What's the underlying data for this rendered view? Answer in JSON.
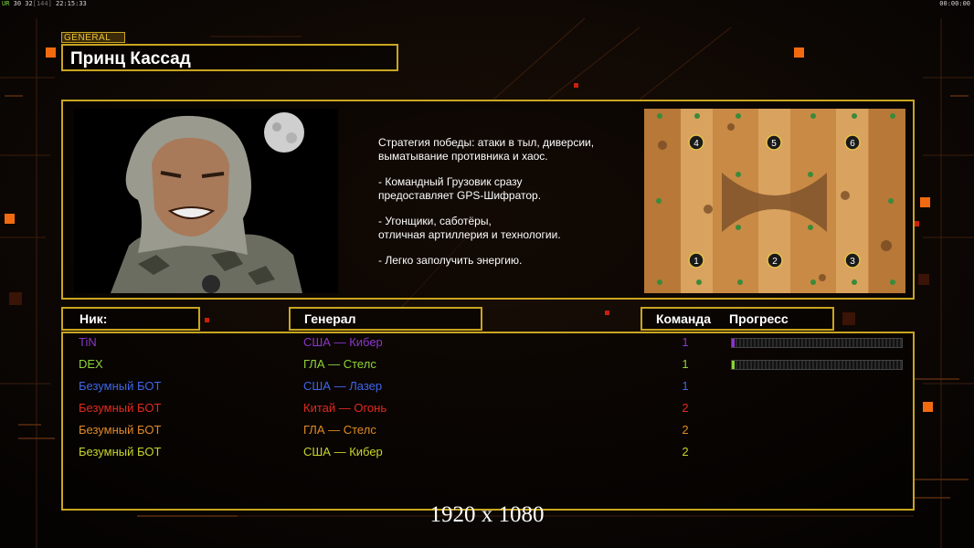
{
  "hud": {
    "left": {
      "a": "UR",
      "b": "30 32",
      "c": "[144]",
      "d": "22:15:33"
    },
    "right": "00:00:00"
  },
  "general": {
    "tag": "GENERAL",
    "name": "Принц Кассад"
  },
  "description": [
    "Стратегия победы: атаки в тыл, диверсии,\n выматывание противника и хаос.",
    "- Командный Грузовик сразу\nпредоставляет GPS-Шифратор.",
    "- Угонщики, саботёры,\nотличная артиллерия и технологии.",
    "- Легко заполучить энергию."
  ],
  "map": {
    "slots": [
      "4",
      "5",
      "6",
      "1",
      "2",
      "3"
    ]
  },
  "headers": {
    "nick": "Ник:",
    "general": "Генерал",
    "team": "Команда",
    "progress": "Прогресс"
  },
  "players": [
    {
      "nick": "TiN",
      "general": "США — Кибер",
      "team": "1",
      "color": "#8a35c9",
      "progress": 0.01
    },
    {
      "nick": "DEX",
      "general": "ГЛА — Стелс",
      "team": "1",
      "color": "#8fd43a",
      "progress": 0.01
    },
    {
      "nick": "Безумный БОТ",
      "general": "США — Лазер",
      "team": "1",
      "color": "#3f66e8"
    },
    {
      "nick": "Безумный БОТ",
      "general": "Китай — Огонь",
      "team": "2",
      "color": "#e32a1f"
    },
    {
      "nick": "Безумный БОТ",
      "general": "ГЛА — Стелс",
      "team": "2",
      "color": "#e08a25"
    },
    {
      "nick": "Безумный БОТ",
      "general": "США — Кибер",
      "team": "2",
      "color": "#c8d42a"
    }
  ],
  "resolution": "1920 x 1080"
}
